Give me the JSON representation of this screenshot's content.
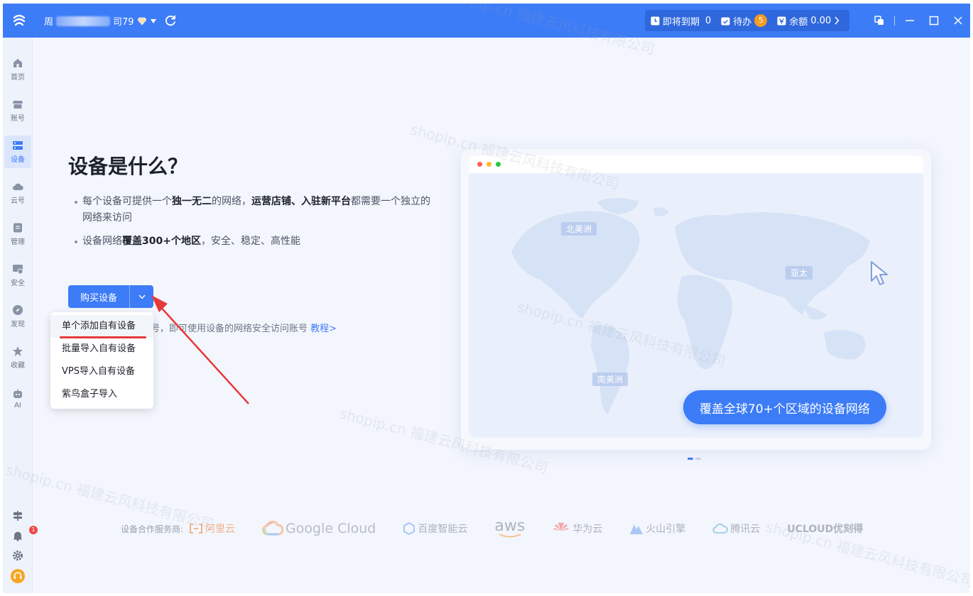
{
  "titlebar": {
    "company_prefix": "周",
    "company_suffix": "司79",
    "status": {
      "expiring_label": "即将到期",
      "expiring_count": "0",
      "todo_label": "待办",
      "todo_count": "5",
      "balance_label": "余额",
      "balance_value": "0.00"
    }
  },
  "sidebar": {
    "items": [
      {
        "label": "首页",
        "icon": "home-icon"
      },
      {
        "label": "账号",
        "icon": "store-icon"
      },
      {
        "label": "设备",
        "icon": "device-icon",
        "active": true
      },
      {
        "label": "云号",
        "icon": "cloud-icon"
      },
      {
        "label": "管理",
        "icon": "manage-icon"
      },
      {
        "label": "安全",
        "icon": "security-icon"
      },
      {
        "label": "发现",
        "icon": "discover-icon"
      },
      {
        "label": "收藏",
        "icon": "star-icon"
      },
      {
        "label": "AI",
        "icon": "robot-icon"
      }
    ],
    "notification_count": "1"
  },
  "main": {
    "title": "设备是什么？",
    "bullet1_a": "每个设备可提供一个",
    "bullet1_b": "独一无二",
    "bullet1_c": "的网络，",
    "bullet1_d": "运营店铺、入驻新平台",
    "bullet1_e": "都需要一个独立的网络来访问",
    "bullet2_a": "设备网络",
    "bullet2_b": "覆盖300+个地区",
    "bullet2_c": "，安全、稳定、高性能",
    "buy_button": "购买设备",
    "hint_text": "号，即可使用设备的网络安全访问账号",
    "hint_link": "教程>",
    "dropdown": [
      "单个添加自有设备",
      "批量导入自有设备",
      "VPS导入自有设备",
      "紫鸟盒子导入"
    ]
  },
  "map_card": {
    "regions": [
      "北美洲",
      "亚太",
      "南美洲"
    ],
    "cover_text": "覆盖全球70+个区域的设备网络"
  },
  "partners": {
    "label": "设备合作服务商:",
    "list": [
      "阿里云",
      "Google Cloud",
      "百度智能云",
      "aws",
      "华为云",
      "火山引擎",
      "腾讯云",
      "UCLOUD优刻得"
    ]
  },
  "watermark": "shopip.cn 福建云风科技有限公司",
  "colors": {
    "primary": "#3d7cf7",
    "badge": "#f59a23",
    "alert": "#f04848",
    "annotation": "#e63a3a"
  }
}
